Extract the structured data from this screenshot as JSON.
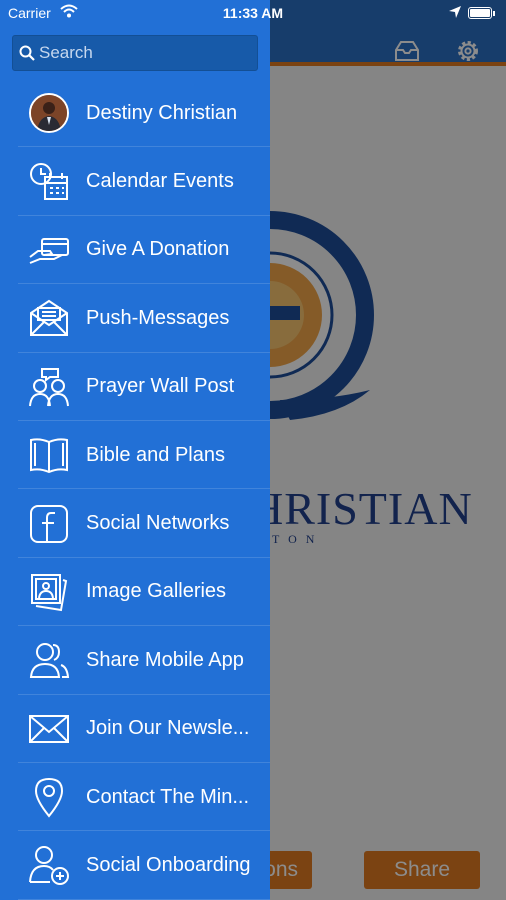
{
  "status_bar": {
    "carrier": "Carrier",
    "time": "11:33 AM"
  },
  "search": {
    "placeholder": "Search"
  },
  "menu": [
    {
      "label": "Destiny Christian",
      "icon": "avatar"
    },
    {
      "label": "Calendar Events",
      "icon": "calendar-clock-icon"
    },
    {
      "label": "Give A Donation",
      "icon": "donation-card-hand-icon"
    },
    {
      "label": "Push-Messages",
      "icon": "envelope-open-icon"
    },
    {
      "label": "Prayer Wall Post",
      "icon": "people-chat-icon"
    },
    {
      "label": "Bible and Plans",
      "icon": "open-book-icon"
    },
    {
      "label": "Social Networks",
      "icon": "facebook-icon"
    },
    {
      "label": "Image Galleries",
      "icon": "photo-stack-icon"
    },
    {
      "label": "Share Mobile App",
      "icon": "users-icon"
    },
    {
      "label": "Join Our Newsle...",
      "icon": "envelope-icon"
    },
    {
      "label": "Contact The Min...",
      "icon": "map-pin-icon"
    },
    {
      "label": "Social Onboarding",
      "icon": "add-user-icon"
    }
  ],
  "background": {
    "logo_text": "HRISTIAN",
    "logo_sub": "TON",
    "left_button": "ons",
    "right_button": "Share"
  },
  "colors": {
    "drawer": "#2270d6",
    "accent": "#e07a22",
    "brand": "#22418c"
  }
}
